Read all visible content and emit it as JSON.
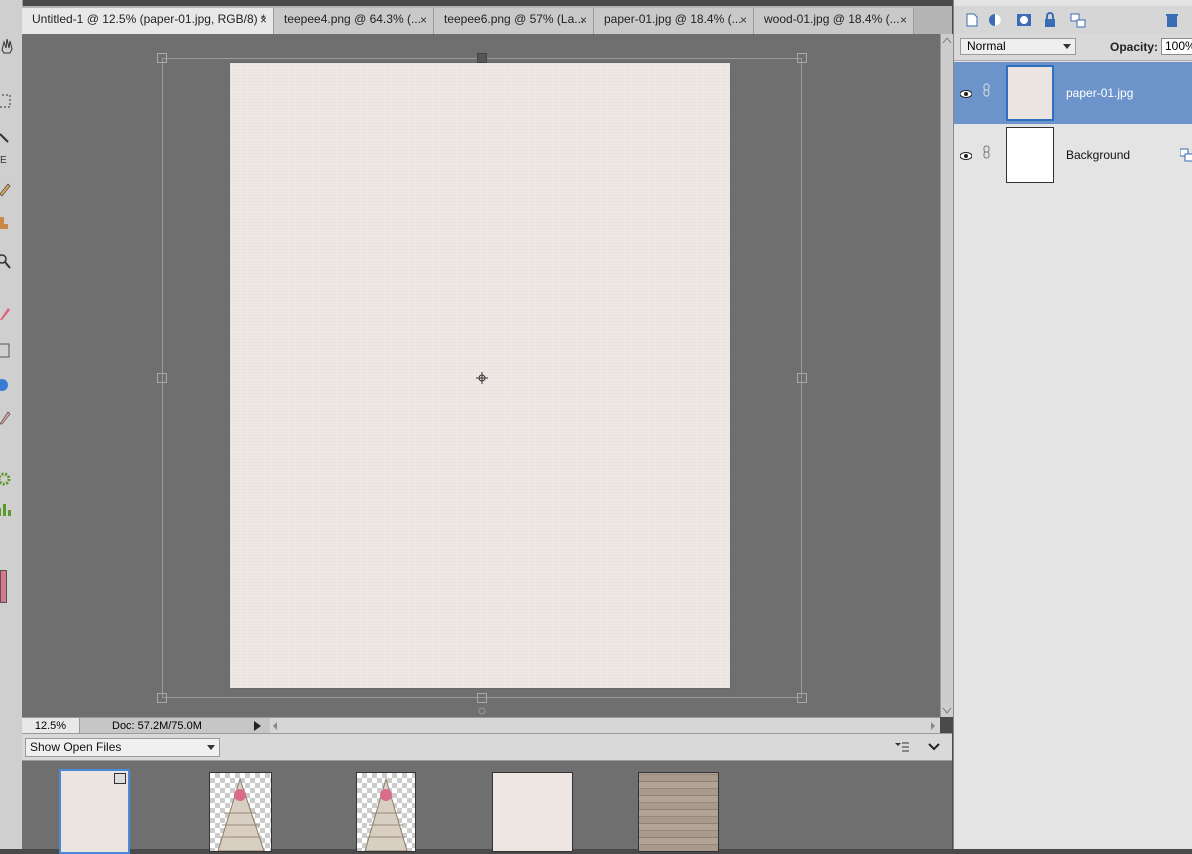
{
  "tabs": [
    {
      "label": "Untitled-1 @ 12.5% (paper-01.jpg, RGB/8) *",
      "active": true
    },
    {
      "label": "teepee4.png @ 64.3% (...",
      "active": false
    },
    {
      "label": "teepee6.png @ 57% (La...",
      "active": false
    },
    {
      "label": "paper-01.jpg @ 18.4% (...",
      "active": false
    },
    {
      "label": "wood-01.jpg @ 18.4% (...",
      "active": false
    }
  ],
  "tab_close_glyph": "×",
  "status": {
    "zoom": "12.5%",
    "doc": "Doc: 57.2M/75.0M"
  },
  "bin": {
    "select_label": "Show Open Files"
  },
  "layers_panel": {
    "blend_mode": "Normal",
    "opacity_label": "Opacity:",
    "opacity_value": "100%",
    "layers": [
      {
        "name": "paper-01.jpg",
        "selected": true
      },
      {
        "name": "Background",
        "selected": false
      }
    ]
  },
  "toolbar_letter": "E",
  "colors": {
    "accent_selected": "#6d93cb",
    "foreground_swatch": "#d9778e",
    "paper": "#efe8e4"
  },
  "icons": [
    "hand-icon",
    "marquee-icon",
    "lasso-icon",
    "brush-icon",
    "stamp-icon",
    "zoom-icon",
    "eraser-icon",
    "gradient-icon",
    "shape-icon",
    "pencil-icon",
    "gear-icon",
    "chart-icon",
    "new-layer-icon",
    "fill-layer-icon",
    "mask-icon",
    "lock-icon",
    "link-icon",
    "trash-icon",
    "eye-icon",
    "bin-menu-icon",
    "chevron-down-icon"
  ]
}
